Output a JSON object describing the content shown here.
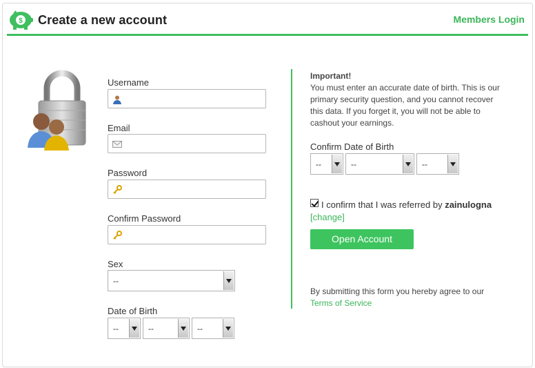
{
  "header": {
    "title": "Create a new account",
    "members_login": "Members Login",
    "brand_color": "#3fbf5f"
  },
  "form": {
    "username": {
      "label": "Username",
      "value": "",
      "icon": "user-icon"
    },
    "email": {
      "label": "Email",
      "value": "",
      "icon": "envelope-icon"
    },
    "password": {
      "label": "Password",
      "value": "",
      "icon": "key-icon"
    },
    "confirm_password": {
      "label": "Confirm Password",
      "value": "",
      "icon": "key-icon"
    },
    "sex": {
      "label": "Sex",
      "value": "--"
    },
    "dob": {
      "label": "Date of Birth",
      "day": "--",
      "month": "--",
      "year": "--"
    }
  },
  "important": {
    "title": "Important!",
    "text": "You must enter an accurate date of birth. This is our primary security question, and you cannot recover this data. If you forget it, you will not be able to cashout your earnings."
  },
  "confirm_dob": {
    "label": "Confirm Date of Birth",
    "day": "--",
    "month": "--",
    "year": "--"
  },
  "referral": {
    "checked": true,
    "text": "I confirm that I was referred by",
    "referrer": "zainulogna",
    "change_link": "[change]"
  },
  "open_account_button": "Open Account",
  "terms": {
    "text": "By submitting this form you hereby agree to our",
    "link": "Terms of Service"
  }
}
